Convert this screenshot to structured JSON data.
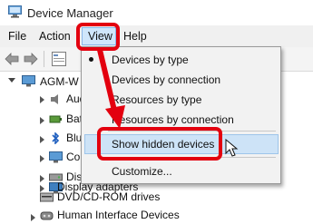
{
  "window": {
    "title": "Device Manager",
    "icon": "device-manager-icon"
  },
  "menubar": {
    "file": "File",
    "action": "Action",
    "view": "View",
    "help": "Help"
  },
  "toolbar": {
    "buttons": [
      "back-arrow-icon",
      "forward-arrow-icon",
      "properties-icon"
    ]
  },
  "tree": {
    "root": "AGM-W",
    "items": [
      {
        "label": "Aud",
        "icon": "audio-icon"
      },
      {
        "label": "Batt",
        "icon": "battery-icon"
      },
      {
        "label": "Blue",
        "icon": "bluetooth-icon"
      },
      {
        "label": "Com",
        "icon": "computer-icon"
      },
      {
        "label": "Disk",
        "icon": "disk-icon"
      },
      {
        "label": "Display adapters",
        "icon": "display-icon"
      },
      {
        "label": "DVD/CD-ROM drives",
        "icon": "dvd-icon"
      },
      {
        "label": "Human Interface Devices",
        "icon": "hid-icon"
      }
    ]
  },
  "view_menu": {
    "items": [
      {
        "label": "Devices by type",
        "selected": true
      },
      {
        "label": "Devices by connection"
      },
      {
        "label": "Resources by type"
      },
      {
        "label": "Resources by connection"
      },
      {
        "label": "Show hidden devices",
        "highlighted": true
      },
      {
        "label": "Customize..."
      }
    ]
  },
  "annotation": {
    "color": "#e3000f"
  }
}
